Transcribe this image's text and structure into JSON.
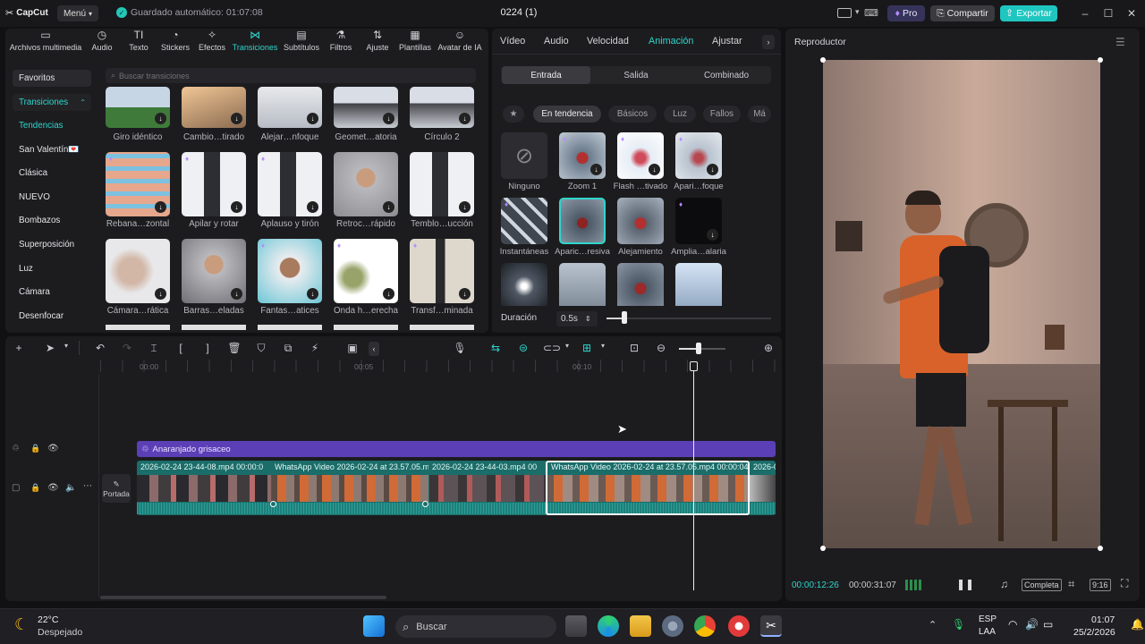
{
  "app": {
    "name": "CapCut",
    "menu": "Menú",
    "autosave": "Guardado automático: 01:07:08",
    "project": "0224 (1)",
    "pro": "Pro",
    "share": "Compartir",
    "export": "Exportar"
  },
  "toolbar": [
    "Archivos multimedia",
    "Audio",
    "Texto",
    "Stickers",
    "Efectos",
    "Transiciones",
    "Subtítulos",
    "Filtros",
    "Ajuste",
    "Plantillas",
    "Avatar de IA"
  ],
  "sidebar": [
    "Favoritos",
    "Transiciones",
    "Tendencias",
    "San Valentín💌",
    "Clásica",
    "NUEVO",
    "Bombazos",
    "Superposición",
    "Luz",
    "Cámara",
    "Desenfocar"
  ],
  "search_placeholder": "Buscar transiciones",
  "transitions": [
    "Giro idéntico",
    "Cambio…tirado",
    "Alejar…nfoque",
    "Geomet…atoria",
    "Círculo 2",
    "Rebana…zontal",
    "Apilar y rotar",
    "Aplauso y tirón",
    "Retroc…rápido",
    "Temblo…ucción",
    "Cámara…rática",
    "Barras…eladas",
    "Fantas…atices",
    "Onda h…erecha",
    "Transf…minada"
  ],
  "anim_tabs": [
    "Vídeo",
    "Audio",
    "Velocidad",
    "Animación",
    "Ajustar"
  ],
  "anim_seg": [
    "Entrada",
    "Salida",
    "Combinado"
  ],
  "anim_chips": [
    "En tendencia",
    "Básicos",
    "Luz",
    "Fallos",
    "Má"
  ],
  "anim_items": [
    "Ninguno",
    "Zoom 1",
    "Flash …tivado",
    "Apari…foque",
    "Instantáneas",
    "Aparic…resiva",
    "Alejamiento",
    "Amplia…alaria"
  ],
  "duration": {
    "label": "Duración",
    "value": "0.5s"
  },
  "player": {
    "title": "Reproductor",
    "current": "00:00:12:26",
    "total": "00:00:31:07",
    "complete": "Completa",
    "ratio": "9:16"
  },
  "timeline": {
    "ruler": [
      "00:00",
      "00:05",
      "00:10"
    ],
    "filter_track": "Anaranjado grisaceo",
    "clips": [
      "2026-02-24 23-44-08.mp4  00:00:0",
      "WhatsApp Video 2026-02-24 at 23.57.05.mp",
      "2026-02-24 23-44-03.mp4  00",
      "WhatsApp Video 2026-02-24 at 23.57.05.mp4  00:00:04",
      "2026-0"
    ],
    "cover": "Portada"
  },
  "taskbar": {
    "temp": "22°C",
    "weather": "Despejado",
    "search": "Buscar",
    "lang1": "ESP",
    "lang2": "LAA",
    "time": "01:07",
    "date": "25/2/2026"
  },
  "colors": {
    "accent": "#1fc6c0",
    "filter": "#5b3fb6",
    "clip": "#1f7f7a"
  }
}
